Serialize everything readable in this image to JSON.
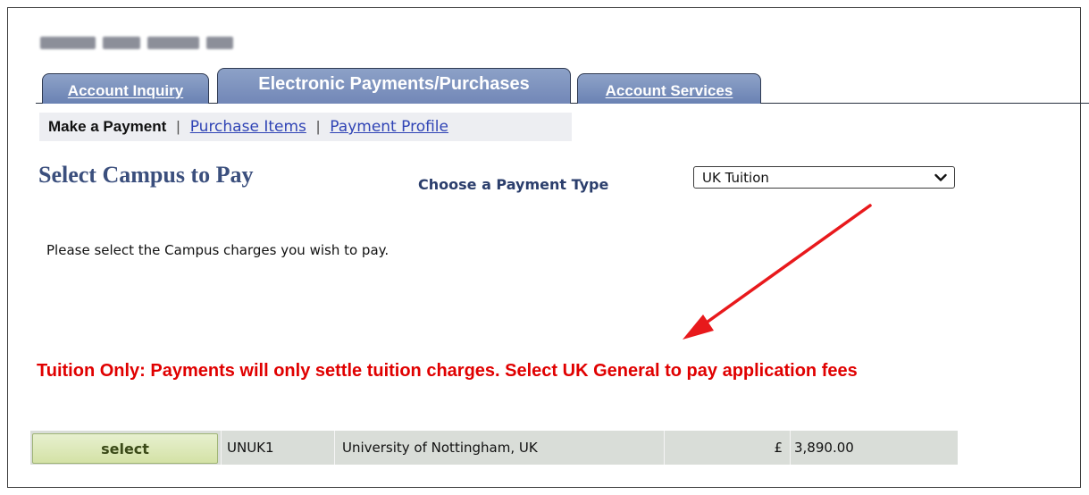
{
  "tabs": [
    {
      "label": "Account Inquiry",
      "state": "inactive"
    },
    {
      "label": "Electronic Payments/Purchases",
      "state": "active"
    },
    {
      "label": "Account Services",
      "state": "inactive"
    }
  ],
  "subnav": {
    "current": "Make a Payment",
    "separator": "|",
    "links": [
      "Purchase Items",
      "Payment Profile"
    ]
  },
  "page": {
    "title": "Select Campus to Pay",
    "payment_type_label": "Choose a Payment Type",
    "payment_type_selected": "UK Tuition",
    "instruction": "Please select the Campus charges you wish to pay.",
    "warning": "Tuition Only: Payments will only settle tuition charges. Select UK General to pay application fees"
  },
  "charges": [
    {
      "action": "select",
      "code": "UNUK1",
      "campus": "University of Nottingham, UK",
      "currency": "£",
      "amount": "3,890.00"
    }
  ],
  "colors": {
    "tab_fill": "#7a8fbd",
    "title": "#3b4f7d",
    "link": "#3044b5",
    "warning": "#e00000",
    "row_bg": "#d9ddd8",
    "annotation_arrow": "#e8191c"
  },
  "icons": {
    "dropdown": "chevron-down-icon",
    "annotation": "red-arrow-annotation"
  }
}
